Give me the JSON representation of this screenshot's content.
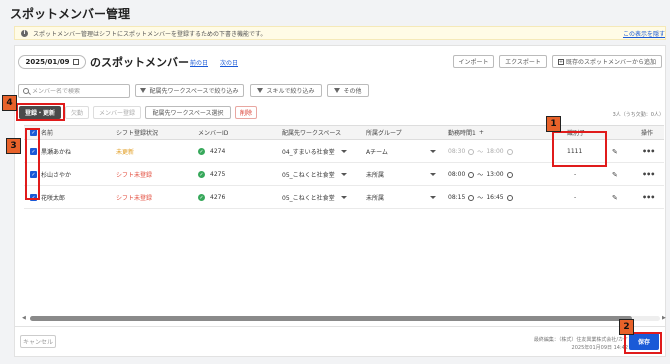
{
  "page": {
    "title": "スポットメンバー管理",
    "notice": "スポットメンバー管理はシフトにスポットメンバーを登録するための下書き機能です。",
    "notice_hide": "この表示を隠す"
  },
  "header": {
    "date": "2025/01/09",
    "heading": "のスポットメンバー",
    "prev_day": "前の日",
    "next_day": "次の日"
  },
  "actions": {
    "import": "インポート",
    "export": "エクスポート",
    "add_existing": "既存のスポットメンバーから追加"
  },
  "filters": {
    "search_placeholder": "メンバー名で検索",
    "workspace_filter": "配属先ワークスペースで絞り込み",
    "skill_filter": "スキルで絞り込み",
    "other": "その他"
  },
  "bulk": {
    "register_update": "登録・更新",
    "absent": "欠勤",
    "member_register": "メンバー登録",
    "workspace_select": "配属先ワークスペース選択",
    "delete": "削除"
  },
  "count_text": "3人（うち欠勤：0人）",
  "table": {
    "columns": [
      "名前",
      "シフト登録状況",
      "メンバーID",
      "配属先ワークスペース",
      "所属グループ",
      "勤務時間1",
      "識別子",
      "操作"
    ],
    "rows": [
      {
        "name": "黒瀬あかね",
        "status": "未更新",
        "member_id": "4274",
        "workspace": "04_すまいる社食堂",
        "group": "Aチーム",
        "start": "08:30",
        "end": "18:00",
        "identifier": "1111"
      },
      {
        "name": "杉山さやか",
        "status": "シフト未登録",
        "member_id": "4275",
        "workspace": "05_こねくと社食堂",
        "group": "未所属",
        "start": "08:00",
        "end": "13:00",
        "identifier": "-"
      },
      {
        "name": "花咲太郎",
        "status": "シフト未登録",
        "member_id": "4276",
        "workspace": "05_こねくと社食堂",
        "group": "未所属",
        "start": "08:15",
        "end": "16:45",
        "identifier": "-"
      }
    ]
  },
  "footer": {
    "cancel": "キャンセル",
    "save": "保存",
    "edit_info_1": "最終編集：（株式）住友興業株式会社/カケ",
    "edit_info_2": "2025年01月09日 14:42"
  },
  "annotations": [
    "1",
    "2",
    "3",
    "4"
  ],
  "colors": {
    "accent": "#1a5ad7",
    "annotation_border": "#e01b1b",
    "annotation_badge": "#e8622a",
    "error": "#e24a3a",
    "warning": "#e09a1a"
  }
}
